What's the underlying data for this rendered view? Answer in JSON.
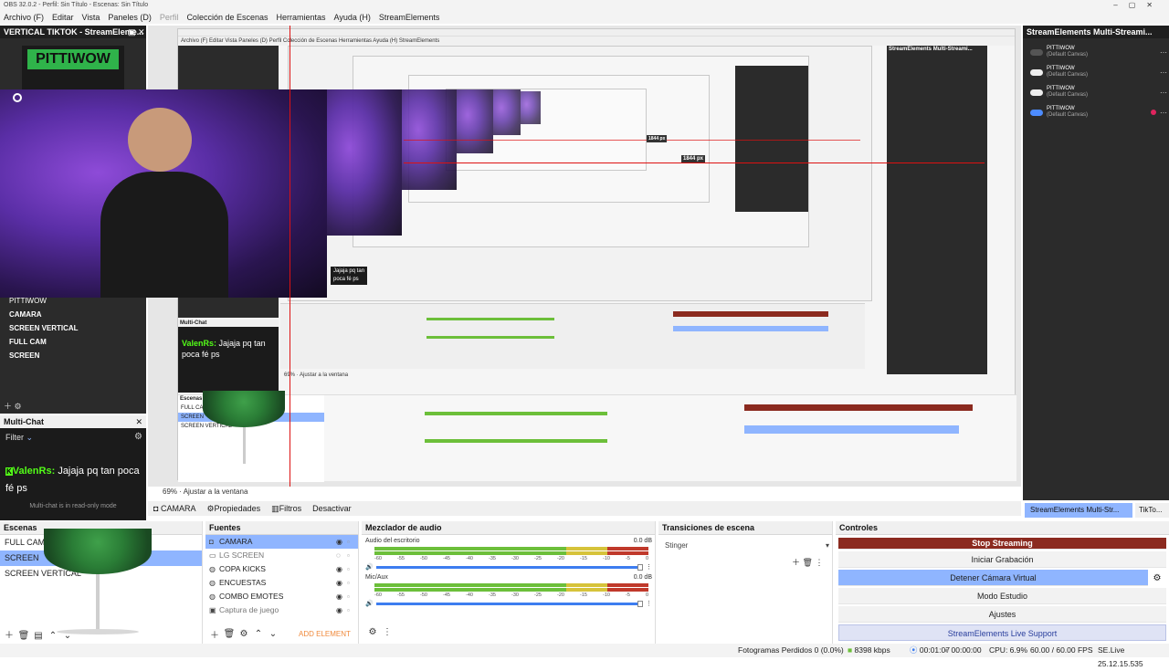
{
  "titlebar": {
    "title": "OBS 32.0.2 - Perfil: Sin Título - Escenas: Sin Título",
    "controls": [
      "–",
      "▢",
      "✕"
    ]
  },
  "menu": [
    {
      "label": "Archivo (F)",
      "disabled": false
    },
    {
      "label": "Editar",
      "disabled": false
    },
    {
      "label": "Vista",
      "disabled": false
    },
    {
      "label": "Paneles (D)",
      "disabled": false
    },
    {
      "label": "Perfil",
      "disabled": true
    },
    {
      "label": "Colección de Escenas",
      "disabled": false
    },
    {
      "label": "Herramientas",
      "disabled": false
    },
    {
      "label": "Ayuda (H)",
      "disabled": false
    },
    {
      "label": "StreamElements",
      "disabled": false
    }
  ],
  "left_dock": {
    "tiktok_title": "VERTICAL TIKTOK - StreamEleme...",
    "brand_text": "PITTIWOW",
    "scene_list": [
      "PITTIWOW",
      "CAMARA",
      "SCREEN VERTICAL",
      "FULL CAM",
      "SCREEN"
    ],
    "multichat": {
      "title": "Multi-Chat",
      "filter_label": "Filter",
      "user": "ValenRs:",
      "message": "Jajaja pq tan poca fé ps",
      "readonly_note": "Multi-chat is in read-only mode"
    }
  },
  "preview": {
    "zoom": "69%",
    "fit_label": "Ajustar a la ventana",
    "dim_label": "1844 px",
    "dim_label_small": "1844 px",
    "nested_chat_line1": "Jajaja pq tan",
    "nested_chat_line2": "poca fé ps"
  },
  "right_dock": {
    "title": "StreamElements Multi-Streami...",
    "entries": [
      {
        "name": "PITTIWOW",
        "canvas": "(Default Canvas)",
        "on": false
      },
      {
        "name": "PITTIWOW",
        "canvas": "(Default Canvas)",
        "on": false
      },
      {
        "name": "PITTIWOW",
        "canvas": "(Default Canvas)",
        "on": false
      },
      {
        "name": "PITTIWOW",
        "canvas": "(Default Canvas)",
        "on": true
      }
    ],
    "tabs": [
      "StreamElements Multi-Str...",
      "TikTo..."
    ]
  },
  "source_toolbar": {
    "source": "CAMARA",
    "props": "Propiedades",
    "filters": "Filtros",
    "deactivate": "Desactivar"
  },
  "scenes": {
    "title": "Escenas",
    "items": [
      "FULL CAM",
      "SCREEN",
      "SCREEN VERTICAL"
    ],
    "selected": 1
  },
  "sources": {
    "title": "Fuentes",
    "items": [
      "CAMARA",
      "LG SCREEN",
      "COPA KICKS",
      "ENCUESTAS",
      "COMBO EMOTES",
      "Captura de juego"
    ],
    "selected": 0,
    "add_label": "ADD ELEMENT"
  },
  "mixer": {
    "title": "Mezclador de audio",
    "channels": [
      {
        "name": "Audio del escritorio",
        "db": "0.0 dB"
      },
      {
        "name": "Mic/Aux",
        "db": "0.0 dB"
      }
    ],
    "ticks": [
      "-60",
      "-55",
      "-50",
      "-45",
      "-40",
      "-35",
      "-30",
      "-25",
      "-20",
      "-15",
      "-10",
      "-5",
      "0"
    ]
  },
  "transitions": {
    "title": "Transiciones de escena",
    "value": "Stinger"
  },
  "controls": {
    "title": "Controles",
    "buttons": [
      "Stop Streaming",
      "Iniciar Grabación",
      "Detener Cámara Virtual",
      "Modo Estudio",
      "Ajustes",
      "StreamElements Live Support"
    ]
  },
  "status": {
    "dropped": "Fotogramas Perdidos 0 (0.0%)",
    "kbps": "8398 kbps",
    "stream_time": "00:01:07",
    "rec_time": "00:00:00",
    "cpu": "CPU: 6.9%",
    "fps": "60.00 / 60.00 FPS",
    "version": "SE.Live 25.12.15.535"
  },
  "colors": {
    "accent": "#8fb5ff",
    "stop": "#8b2a1f",
    "live": "#6cbf3a",
    "redline": "#dd1111"
  }
}
